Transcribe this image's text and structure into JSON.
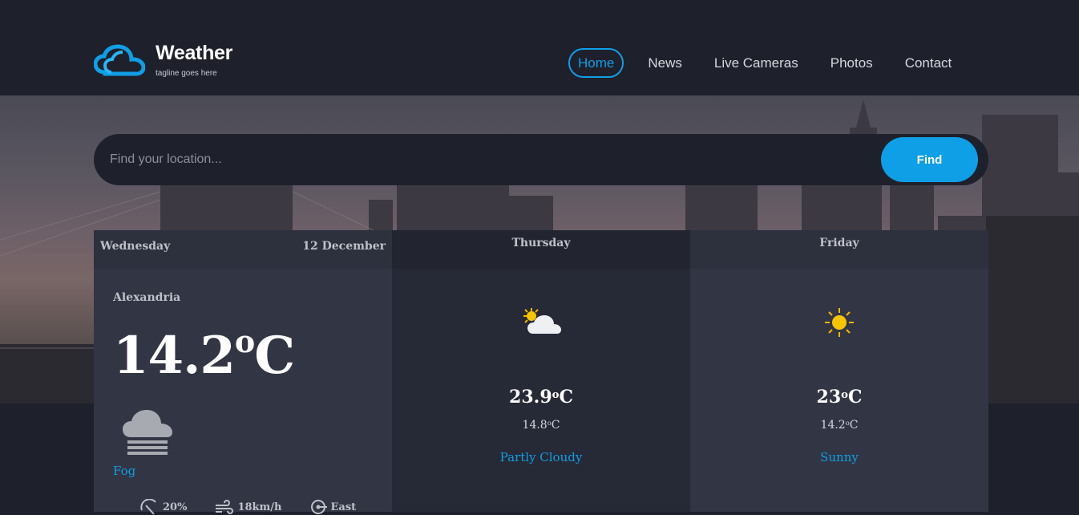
{
  "brand": {
    "title": "Weather",
    "tagline": "tagline goes here",
    "icon": "cloud-icon",
    "accent": "#0f9fe6"
  },
  "nav": {
    "items": [
      "Home",
      "News",
      "Live Cameras",
      "Photos",
      "Contact"
    ],
    "active": "Home"
  },
  "search": {
    "placeholder": "Find your location...",
    "button_label": "Find"
  },
  "today": {
    "day": "Wednesday",
    "date": "12 December",
    "location": "Alexandria",
    "temp": "14.2",
    "temp_unit": "o",
    "temp_scale": "C",
    "icon": "fog-icon",
    "condition": "Fog",
    "humidity": "20%",
    "wind": "18km/h",
    "direction": "East"
  },
  "forecast": [
    {
      "day": "Thursday",
      "high": "23.9",
      "low": "14.8",
      "icon": "partly-cloudy-icon",
      "condition": "Partly Cloudy"
    },
    {
      "day": "Friday",
      "high": "23",
      "low": "14.2",
      "icon": "sun-icon",
      "condition": "Sunny"
    }
  ],
  "units": {
    "deg": "o",
    "scale": "C"
  }
}
